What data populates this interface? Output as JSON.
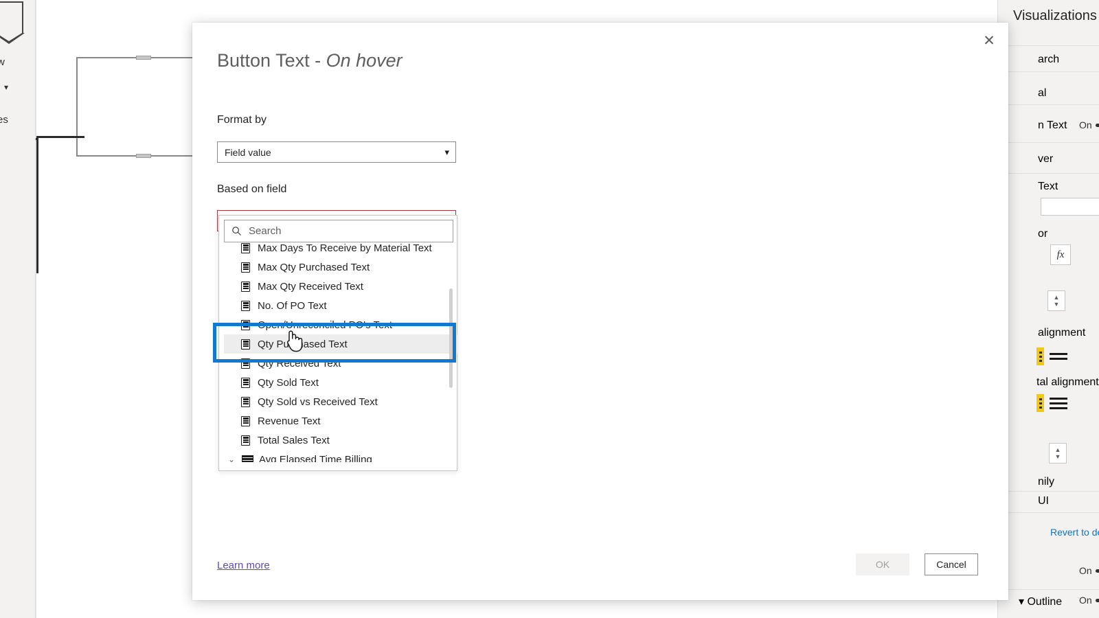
{
  "app": {
    "ribbon_fragments": [
      "w",
      "es"
    ],
    "canvas_dots": "···"
  },
  "viz_pane": {
    "title": "Visualizations",
    "collapse_icon": "chevron-left-icon",
    "search_label": "arch",
    "general_label": "al",
    "button_text_label": "n Text",
    "button_text_toggle": "On",
    "on_hover_label": "ver",
    "text_label": "Text",
    "text_value": "",
    "color_label": "or",
    "fx_label": "fx",
    "vertical_alignment_label": "alignment",
    "horizontal_alignment_label": "tal alignment",
    "font_family_label": "nily",
    "font_family_value": "UI",
    "revert_label": "Revert to defa",
    "toggle_bottom": "On",
    "outline_label": "Outline",
    "outline_toggle": "On"
  },
  "dialog": {
    "title_main": "Button Text - ",
    "title_em": "On hover",
    "close_icon": "close-icon",
    "format_by_label": "Format by",
    "format_by_value": "Field value",
    "based_on_field_label": "Based on field",
    "based_on_field_value": "",
    "chevron_icon": "chevron-down-icon",
    "search_icon": "search-icon",
    "search_placeholder": "Search",
    "learn_more": "Learn more",
    "ok_label": "OK",
    "cancel_label": "Cancel",
    "highlight_color": "#1379d0",
    "error_border_color": "#a4373a",
    "items": [
      {
        "label": "Max Days To Receive by Material Text",
        "icon": "measure-icon",
        "type": "measure",
        "state": "clipped"
      },
      {
        "label": "Max Qty Purchased Text",
        "icon": "measure-icon",
        "type": "measure",
        "state": "normal"
      },
      {
        "label": "Max Qty Received Text",
        "icon": "measure-icon",
        "type": "measure",
        "state": "normal"
      },
      {
        "label": "No. Of PO Text",
        "icon": "measure-icon",
        "type": "measure",
        "state": "normal"
      },
      {
        "label": "Open/Unreconciled PO's Text",
        "icon": "measure-icon",
        "type": "measure",
        "state": "normal"
      },
      {
        "label": "Qty Purchased Text",
        "icon": "measure-icon",
        "type": "measure",
        "state": "hovered"
      },
      {
        "label": "Qty Received Text",
        "icon": "measure-icon",
        "type": "measure",
        "state": "normal"
      },
      {
        "label": "Qty Sold Text",
        "icon": "measure-icon",
        "type": "measure",
        "state": "normal"
      },
      {
        "label": "Qty Sold vs Received Text",
        "icon": "measure-icon",
        "type": "measure",
        "state": "normal"
      },
      {
        "label": "Revenue Text",
        "icon": "measure-icon",
        "type": "measure",
        "state": "normal"
      },
      {
        "label": "Total Sales Text",
        "icon": "measure-icon",
        "type": "measure",
        "state": "normal"
      },
      {
        "label": "Avg Elapsed Time Billing",
        "icon": "table-icon",
        "type": "table",
        "state": "normal"
      }
    ]
  }
}
